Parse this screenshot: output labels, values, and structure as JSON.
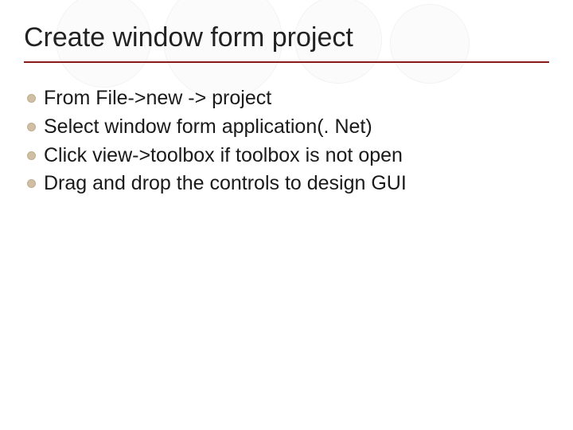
{
  "title": "Create window form project",
  "bullets": [
    "From File->new -> project",
    "Select window form application(. Net)",
    "Click view->toolbox if toolbox is not open",
    "Drag and drop the controls to design GUI"
  ],
  "colors": {
    "underline": "#8b1a1a",
    "bullet": "#d0bfa4"
  }
}
